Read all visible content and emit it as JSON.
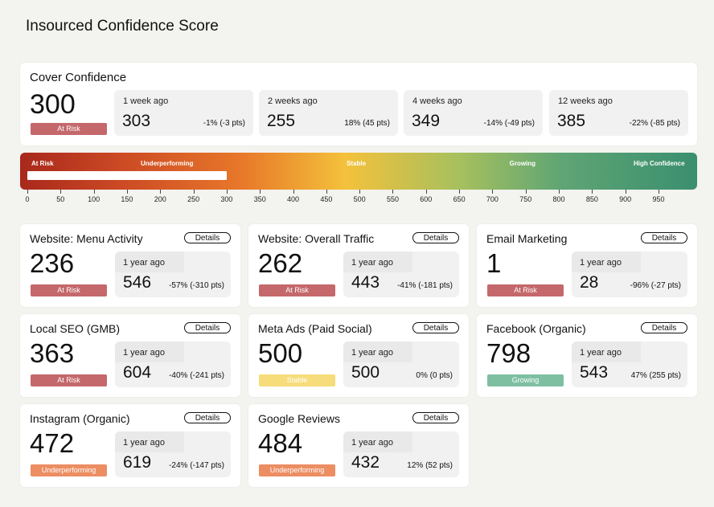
{
  "page": {
    "title": "Insourced Confidence Score"
  },
  "status_colors": {
    "At Risk": "#c4686b",
    "Underperforming": "#ec8d62",
    "Stable": "#f6dc7a",
    "Growing": "#7ebfa2"
  },
  "cover": {
    "name": "Cover Confidence",
    "score": "300",
    "status": "At Risk",
    "history": [
      {
        "label": "1 week ago",
        "value": "303",
        "change": "-1% (-3 pts)"
      },
      {
        "label": "2 weeks ago",
        "value": "255",
        "change": "18% (45 pts)"
      },
      {
        "label": "4 weeks ago",
        "value": "349",
        "change": "-14% (-49 pts)"
      },
      {
        "label": "12 weeks ago",
        "value": "385",
        "change": "-22% (-85 pts)"
      }
    ]
  },
  "gauge": {
    "value": 300,
    "min": 0,
    "max": 1000,
    "zones": [
      {
        "label": "At Risk",
        "at": 0
      },
      {
        "label": "Underperforming",
        "at": 210
      },
      {
        "label": "Stable",
        "at": 495
      },
      {
        "label": "Growing",
        "at": 745
      },
      {
        "label": "High Confidence",
        "at": 960
      }
    ],
    "ticks": [
      "0",
      "50",
      "100",
      "150",
      "200",
      "250",
      "300",
      "350",
      "400",
      "450",
      "500",
      "550",
      "600",
      "650",
      "700",
      "750",
      "800",
      "850",
      "900",
      "950"
    ]
  },
  "details_label": "Details",
  "metrics": [
    {
      "name": "Website: Menu Activity",
      "score": "236",
      "status": "At Risk",
      "history_label": "1 year ago",
      "history_value": "546",
      "change": "-57% (-310 pts)"
    },
    {
      "name": "Website: Overall Traffic",
      "score": "262",
      "status": "At Risk",
      "history_label": "1 year ago",
      "history_value": "443",
      "change": "-41% (-181 pts)"
    },
    {
      "name": "Email Marketing",
      "score": "1",
      "status": "At Risk",
      "history_label": "1 year ago",
      "history_value": "28",
      "change": "-96% (-27 pts)"
    },
    {
      "name": "Local SEO (GMB)",
      "score": "363",
      "status": "At Risk",
      "history_label": "1 year ago",
      "history_value": "604",
      "change": "-40% (-241 pts)"
    },
    {
      "name": "Meta Ads (Paid Social)",
      "score": "500",
      "status": "Stable",
      "history_label": "1 year ago",
      "history_value": "500",
      "change": "0% (0 pts)"
    },
    {
      "name": "Facebook (Organic)",
      "score": "798",
      "status": "Growing",
      "history_label": "1 year ago",
      "history_value": "543",
      "change": "47% (255 pts)"
    },
    {
      "name": "Instagram (Organic)",
      "score": "472",
      "status": "Underperforming",
      "history_label": "1 year ago",
      "history_value": "619",
      "change": "-24% (-147 pts)"
    },
    {
      "name": "Google Reviews",
      "score": "484",
      "status": "Underperforming",
      "history_label": "1 year ago",
      "history_value": "432",
      "change": "12% (52 pts)"
    }
  ]
}
